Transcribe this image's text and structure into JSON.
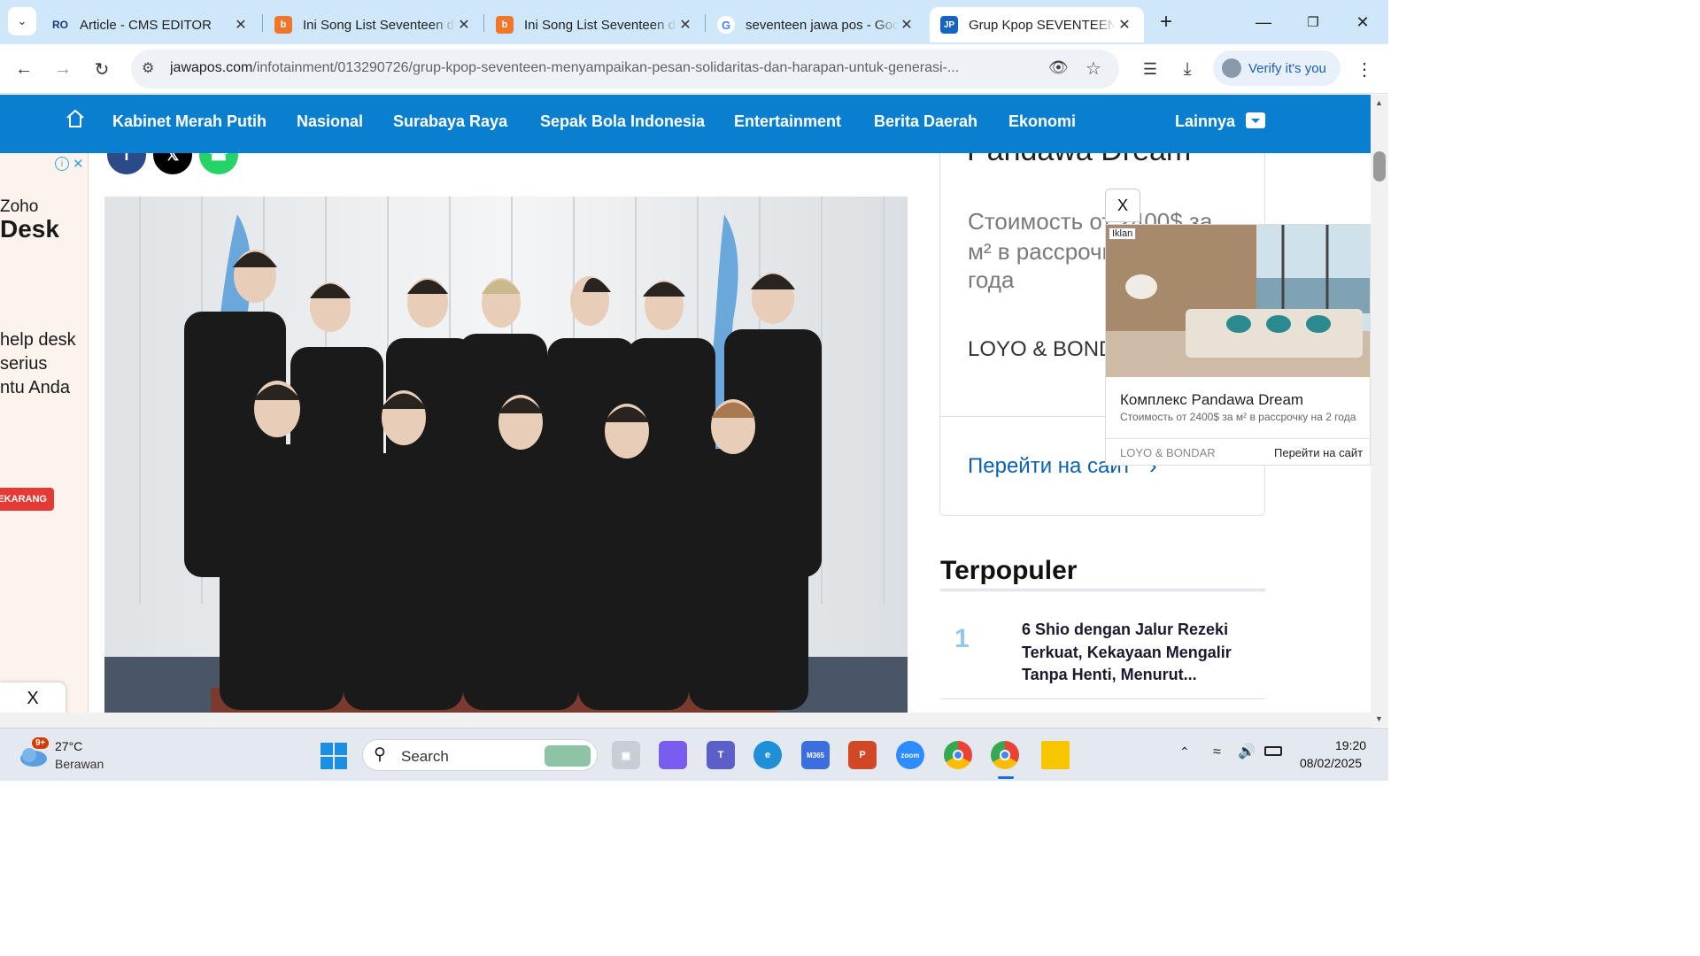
{
  "browser": {
    "tabs": [
      {
        "title": "Article - CMS EDITOR",
        "favicon": "cms-logo-icon",
        "active": false
      },
      {
        "title": "Ini Song List Seventeen di",
        "favicon": "bing-icon",
        "active": false
      },
      {
        "title": "Ini Song List Seventeen di",
        "favicon": "bing-icon",
        "active": false
      },
      {
        "title": "seventeen jawa pos - Goo",
        "favicon": "google-icon",
        "active": false
      },
      {
        "title": "Grup Kpop SEVENTEEN M",
        "favicon": "jawapos-icon",
        "active": true
      }
    ],
    "jp_favicon_text": "JP",
    "cms_favicon_text": "RO",
    "url_host": "jawapos.com",
    "url_path": "/infotainment/013290726/grup-kpop-seventeen-menyampaikan-pesan-solidaritas-dan-harapan-untuk-generasi-...",
    "verify_label": "Verify it's you"
  },
  "site_nav": {
    "items": [
      "Kabinet Merah Putih",
      "Nasional",
      "Surabaya Raya",
      "Sepak Bola Indonesia",
      "Entertainment",
      "Berita Daerah",
      "Ekonomi"
    ],
    "more_label": "Lainnya"
  },
  "left_ad": {
    "brand_line1": "Zoho",
    "brand_line2": "Desk",
    "text_lines": [
      "help desk",
      "serius",
      "ntu Anda"
    ],
    "cta": "EKARANG",
    "close": "X"
  },
  "right_card": {
    "title_partial": "Pandawa Dream",
    "desc_partial": "Стоимость от 2400$ за м² в рассрочку на 2 года",
    "desc_lines": [
      "Стоимость от 2400$ за",
      "м² в рассрочку на 2",
      "года"
    ],
    "advertiser": "LOYO & BONDAR",
    "cta": "Перейти на сайт"
  },
  "popup_ad": {
    "close": "X",
    "badge": "Iklan",
    "title": "Комплекс Pandawa Dream",
    "desc": "Стоимость от 2400$ за м² в рассрочку на 2 года",
    "advertiser": "LOYO & BONDAR",
    "cta": "Перейти на сайт"
  },
  "popular": {
    "heading": "Terpopuler",
    "items": [
      {
        "rank": "1",
        "title_lines": [
          "6 Shio dengan Jalur Rezeki",
          "Terkuat, Kekayaan Mengalir",
          "Tanpa Henti, Menurut..."
        ]
      }
    ]
  },
  "taskbar": {
    "weather_badge": "9+",
    "temperature": "27°C",
    "condition": "Berawan",
    "search_placeholder": "Search",
    "time": "19:20",
    "date": "08/02/2025",
    "m365_label": "M365",
    "zoom_label": "zoom"
  },
  "colors": {
    "nav_blue": "#0b7fcf",
    "tab_strip": "#cfe8f9",
    "accent_red": "#e53935",
    "popular_rank": "#8fc9ee"
  }
}
